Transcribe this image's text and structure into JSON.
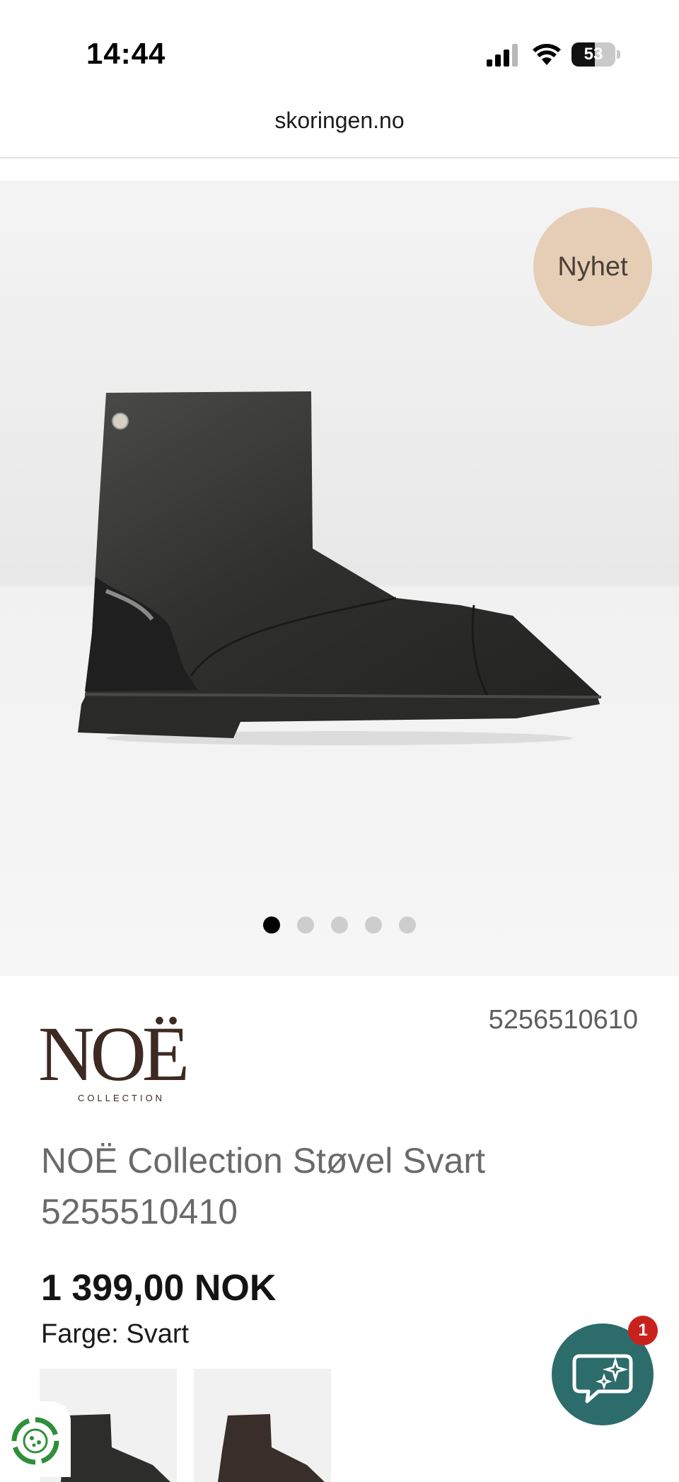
{
  "status_bar": {
    "time": "14:44",
    "battery": "53",
    "battery_level": 0.53
  },
  "browser": {
    "url": "skoringen.no"
  },
  "hero": {
    "badge": "Nyhet",
    "carousel": {
      "count": 5,
      "active_index": 0
    }
  },
  "product": {
    "brand": "NOË",
    "brand_sub": "COLLECTION",
    "sku": "5256510610",
    "title": "NOË Collection Støvel Svart 5255510410",
    "price": "1 399,00 NOK",
    "color_label": "Farge: Svart"
  },
  "chat": {
    "badge_count": "1"
  },
  "colors": {
    "badge_bg": "#e6cdb6",
    "chat_bg": "#2c6c6b",
    "notify_red": "#c9221d",
    "brand_brown": "#3d2a22"
  },
  "icons": {
    "signal": "cellular-signal-icon",
    "wifi": "wifi-icon",
    "battery": "battery-icon",
    "chat": "chat-sparkle-icon",
    "eco": "eco-recycle-icon"
  }
}
